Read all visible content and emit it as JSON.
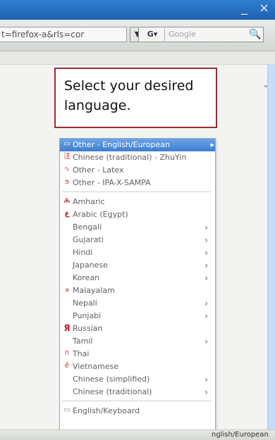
{
  "browser": {
    "url_text": "t=firefox-a&rls=cor",
    "search_placeholder": "Google",
    "search_engine_label": "G▾",
    "window_minimize_symbol": "_",
    "window_close_symbol": "×"
  },
  "instruction": {
    "text": "Select your desired language."
  },
  "menu": {
    "items": [
      {
        "label": "Other - English/European",
        "icon": "keyboard-icon",
        "has_submenu": true,
        "selected": true
      },
      {
        "label": "Chinese (traditional) - ZhuYin",
        "icon": "chinese-icon",
        "has_submenu": false
      },
      {
        "label": "Other - Latex",
        "icon": "latex-icon",
        "has_submenu": false
      },
      {
        "label": "Other - IPA-X-SAMPA",
        "icon": "ipa-icon",
        "has_submenu": false
      },
      {
        "label": "Amharic",
        "icon": "amharic-icon",
        "has_submenu": false
      },
      {
        "label": "Arabic (Egypt)",
        "icon": "arabic-icon",
        "has_submenu": false
      },
      {
        "label": "Bengali",
        "icon": "",
        "has_submenu": true
      },
      {
        "label": "Gujarati",
        "icon": "",
        "has_submenu": true
      },
      {
        "label": "Hindi",
        "icon": "",
        "has_submenu": true
      },
      {
        "label": "Japanese",
        "icon": "",
        "has_submenu": true
      },
      {
        "label": "Korean",
        "icon": "",
        "has_submenu": true
      },
      {
        "label": "Malayalam",
        "icon": "malayalam-icon",
        "has_submenu": false
      },
      {
        "label": "Nepali",
        "icon": "",
        "has_submenu": true
      },
      {
        "label": "Punjabi",
        "icon": "",
        "has_submenu": true
      },
      {
        "label": "Russian",
        "icon": "russian-icon",
        "has_submenu": false
      },
      {
        "label": "Tamil",
        "icon": "",
        "has_submenu": true
      },
      {
        "label": "Thai",
        "icon": "thai-icon",
        "has_submenu": false
      },
      {
        "label": "Vietnamese",
        "icon": "vietnamese-icon",
        "has_submenu": false
      },
      {
        "label": "Chinese (simplified)",
        "icon": "",
        "has_submenu": true
      },
      {
        "label": "Chinese (traditional)",
        "icon": "",
        "has_submenu": true
      },
      {
        "label": "English/Keyboard",
        "icon": "keyboard-icon",
        "has_submenu": false
      }
    ]
  },
  "status_bar": {
    "layout_label": "nglish/European"
  },
  "colors": {
    "accent": "#3e7ed0",
    "callout_border": "#9e2b32"
  }
}
